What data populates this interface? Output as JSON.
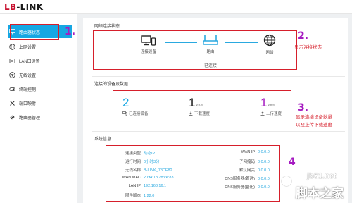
{
  "brand": {
    "logo_accent": "LB",
    "logo_rest": "-LINK"
  },
  "sidebar": {
    "items": [
      {
        "label": "路由器状态",
        "icon": "monitor-icon",
        "active": true
      },
      {
        "label": "上网设置",
        "icon": "globe-icon"
      },
      {
        "label": "LAN口设置",
        "icon": "lan-icon"
      },
      {
        "label": "无线设置",
        "icon": "wifi-icon"
      },
      {
        "label": "终端控制",
        "icon": "control-icon"
      },
      {
        "label": "端口映射",
        "icon": "tools-icon"
      },
      {
        "label": "路由器管理",
        "icon": "gear-icon"
      }
    ]
  },
  "annotations": {
    "n1": "1.",
    "n2": "2.",
    "n2_text": "显示连接状态",
    "n3": "3.",
    "n3_text_1": "显示连接设备数量",
    "n3_text_2": "以及上传下载速度",
    "n4": "4"
  },
  "network": {
    "title": "网络连接状态",
    "device1": "连接设备",
    "device2": "路由",
    "device3": "网络",
    "status": "已连接"
  },
  "devices": {
    "title": "连接的设备及数据",
    "count": "2",
    "count_label": "已连接设备",
    "download": "1",
    "download_unit": "KB/S",
    "download_label": "下载速度",
    "upload": "1",
    "upload_unit": "KB/S",
    "upload_label": "上传速度"
  },
  "sysinfo": {
    "title": "系统信息",
    "left": [
      {
        "k": "连接类型",
        "v": "动态IP"
      },
      {
        "k": "运行时间",
        "v": "0小时3分"
      },
      {
        "k": "无线名称",
        "v": "B-LINK_78CE82"
      },
      {
        "k": "WAN MAC",
        "v": "20:f4:1b:78:ce:83"
      },
      {
        "k": "LAN IP",
        "v": "192.168.16.1"
      },
      {
        "k": "固件版本",
        "v": "1.22.0"
      }
    ],
    "right": [
      {
        "k": "WAN IP",
        "v": "0.0.0.0"
      },
      {
        "k": "子网掩码",
        "v": "0.0.0.0"
      },
      {
        "k": "默认网关",
        "v": "0.0.0.0"
      },
      {
        "k": "DNS服务器(首选)",
        "v": "0.0.0.0"
      },
      {
        "k": "DNS服务器(备用)",
        "v": "0.0.0.0"
      }
    ]
  },
  "watermark": {
    "line1": "jb51.net",
    "line2": "脚本之家"
  }
}
